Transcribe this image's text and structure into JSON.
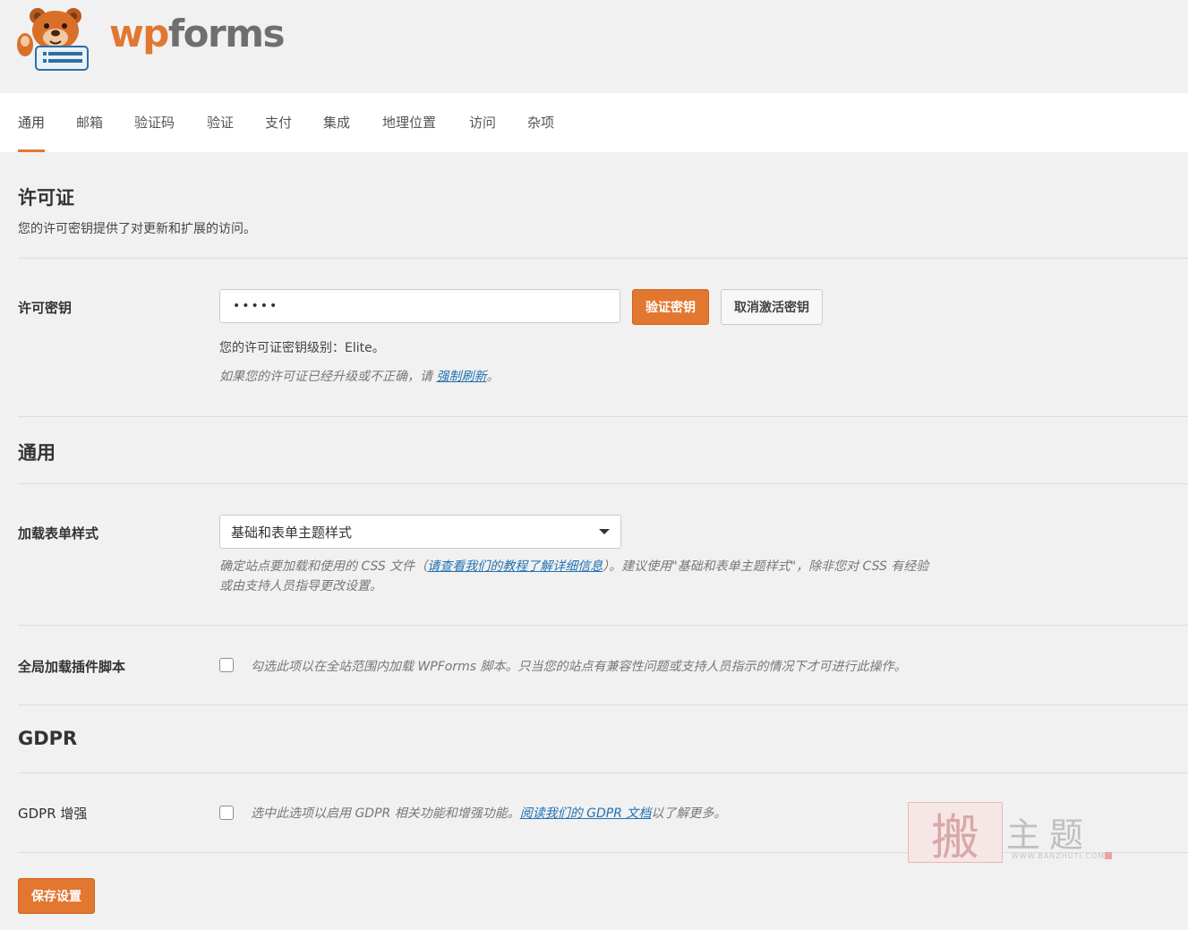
{
  "brand": {
    "wp": "wp",
    "forms": "forms",
    "accent": "#e27730"
  },
  "tabs": [
    {
      "label": "通用",
      "active": true
    },
    {
      "label": "邮箱"
    },
    {
      "label": "验证码"
    },
    {
      "label": "验证"
    },
    {
      "label": "支付"
    },
    {
      "label": "集成"
    },
    {
      "label": "地理位置"
    },
    {
      "label": "访问"
    },
    {
      "label": "杂项"
    }
  ],
  "license": {
    "heading": "许可证",
    "description": "您的许可密钥提供了对更新和扩展的访问。",
    "key_label": "许可密钥",
    "key_value": "•••••",
    "verify_button": "验证密钥",
    "deactivate_button": "取消激活密钥",
    "level_text": "您的许可证密钥级别：Elite。",
    "refresh_hint_prefix": "如果您的许可证已经升级或不正确，请",
    "refresh_link": "强制刷新",
    "refresh_hint_suffix": "。"
  },
  "general": {
    "heading": "通用",
    "style_label": "加载表单样式",
    "style_value": "基础和表单主题样式",
    "style_hint_prefix": "确定站点要加载和使用的 CSS 文件（",
    "style_hint_link": "请查看我们的教程了解详细信息",
    "style_hint_suffix": "）。建议使用\"基础和表单主题样式\"，除非您对 CSS 有经验",
    "style_hint_line2": "或由支持人员指导更改设置。",
    "global_label": "全局加载插件脚本",
    "global_text": "勾选此项以在全站范围内加载 WPForms 脚本。只当您的站点有兼容性问题或支持人员指示的情况下才可进行此操作。"
  },
  "gdpr": {
    "heading": "GDPR",
    "label": "GDPR 增强",
    "text_prefix": "选中此选项以启用 GDPR 相关功能和增强功能。",
    "link": "阅读我们的 GDPR 文档",
    "text_suffix": "以了解更多。"
  },
  "save_button": "保存设置",
  "watermark": {
    "seal": "搬",
    "text": "主题",
    "url": "WWW.BANZHUTI.COM"
  }
}
